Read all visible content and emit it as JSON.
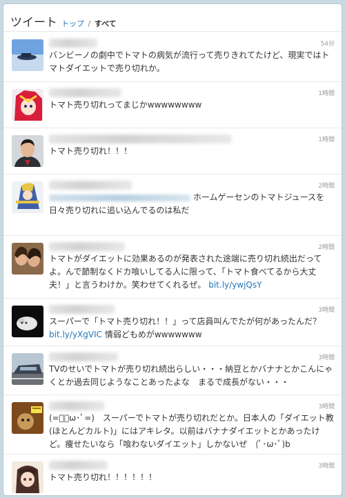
{
  "header": {
    "title": "ツイート",
    "breadcrumb_top": "トップ",
    "breadcrumb_sep": "/",
    "breadcrumb_current": "すべて"
  },
  "tweets": [
    {
      "time": "54分",
      "text": "バンビーノの劇中でトマトの病気が流行って売りきれてたけど、現実ではトマトダイエットで売り切れか。"
    },
    {
      "time": "1時間",
      "text": "トマト売り切れってまじかwwwwwwww"
    },
    {
      "time": "1時間",
      "text": "トマト売り切れ！！！"
    },
    {
      "time": "2時間",
      "text_suffix": "ホームゲーセンのトマトジュースを日々売り切れに追い込んでるのは私だ"
    },
    {
      "time": "2時間",
      "text": "トマトがダイエットに効果あるのが発表された途端に売り切れ続出だってよ。んで節制なくドカ喰いしてる人に限って、「トマト食べてるから大丈夫！」と言うわけか。笑わせてくれるぜ。",
      "link": "bit.ly/ywjQsY"
    },
    {
      "time": "3時間",
      "text": "スーパーで「トマト売り切れ！！」って店員叫んでたが何があったんだ？",
      "link": "bit.ly/yXgVIC",
      "text_after": " 情弱どもめがwwwwwww"
    },
    {
      "time": "3時間",
      "text": "TVのせいでトマトが売り切れ続出らしい・・・納豆とかバナナとかこんにゃくとか過去同じようなことあったよな　まるで成長がない・・・"
    },
    {
      "time": "3時間",
      "text": "(=ﾟ･ω･ﾟ=)　スーパーでトマトが売り切れだとか。日本人の「ダイエット教(ほとんどカルト)」にはアキレタ。以前はバナナダイエットとかあったけど。痩せたいなら「喰わないダイエット」しかないぜ　(ﾟ･ω･ﾟ)b"
    },
    {
      "time": "3時間",
      "text": "トマト売り切れ！！！！！！"
    }
  ]
}
